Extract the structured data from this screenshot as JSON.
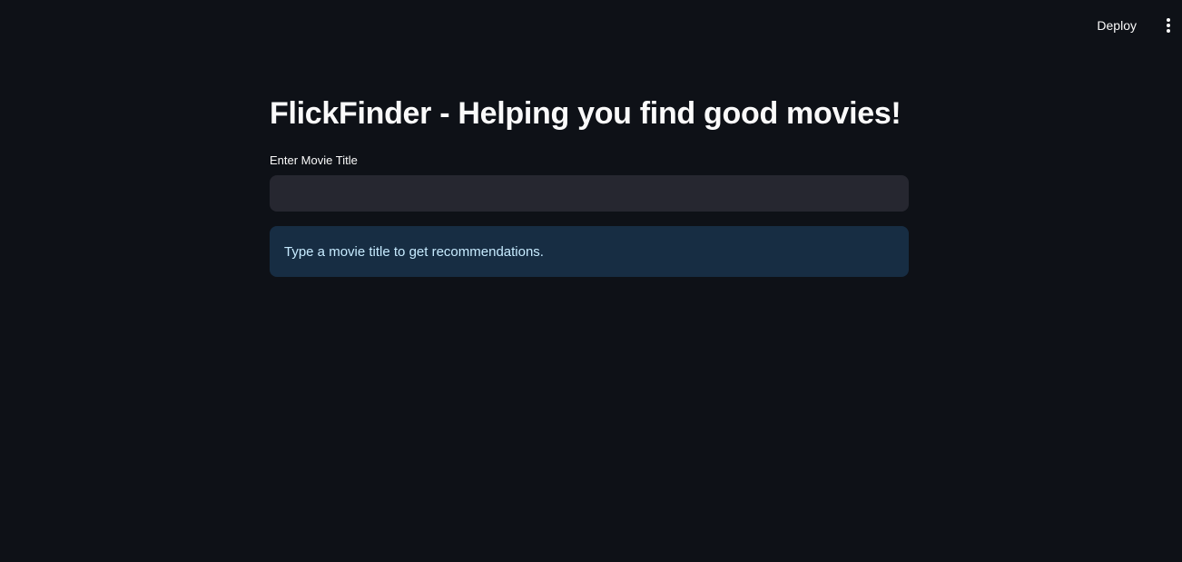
{
  "header": {
    "deploy_label": "Deploy",
    "menu_icon": "vertical-dots-icon"
  },
  "main": {
    "title": "FlickFinder - Helping you find good movies!",
    "input_label": "Enter Movie Title",
    "input_value": "",
    "input_placeholder": "",
    "info_message": "Type a movie title to get recommendations."
  },
  "colors": {
    "background": "#0e1117",
    "input_background": "#262730",
    "info_background": "#172d43",
    "info_text": "#c7ebff",
    "text": "#fafafa"
  }
}
